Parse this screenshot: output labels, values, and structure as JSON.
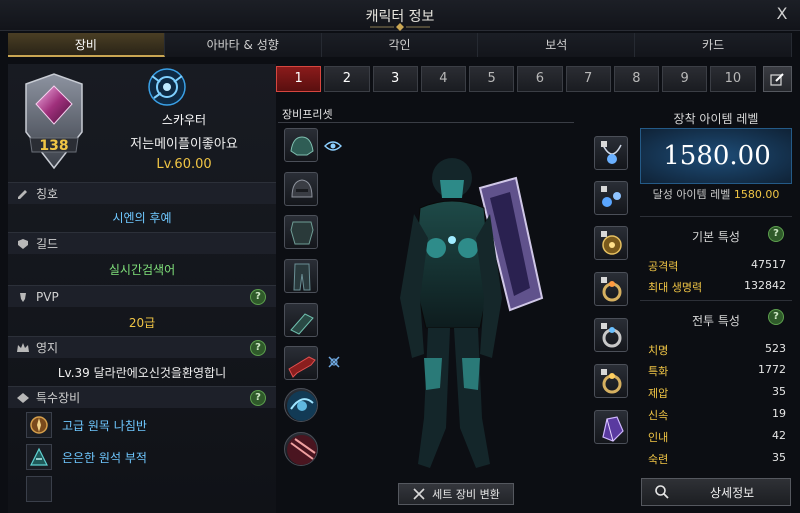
{
  "window": {
    "title": "캐릭터 정보",
    "close": "X"
  },
  "tabs": [
    {
      "label": "장비",
      "active": true
    },
    {
      "label": "아바타 & 성향",
      "active": false
    },
    {
      "label": "각인",
      "active": false
    },
    {
      "label": "보석",
      "active": false
    },
    {
      "label": "카드",
      "active": false
    }
  ],
  "profile": {
    "emblem_level": "138",
    "class_name": "스카우터",
    "character_name": "저는메이플이좋아요",
    "level": "Lv.60.00"
  },
  "sections": {
    "title": {
      "label": "칭호",
      "value": "시엔의 후예"
    },
    "guild": {
      "label": "길드",
      "value": "실시간검색어"
    },
    "pvp": {
      "label": "PVP",
      "value": "20급"
    },
    "territory": {
      "label": "영지",
      "value": "Lv.39 달라란에오신것을환영합니"
    },
    "special": {
      "label": "특수장비",
      "items": [
        {
          "label": "고급 원목 나침반"
        },
        {
          "label": "은은한 원석 부적"
        }
      ]
    },
    "help_glyph": "?"
  },
  "slots": [
    "1",
    "2",
    "3",
    "4",
    "5",
    "6",
    "7",
    "8",
    "9",
    "10"
  ],
  "preset": {
    "label": "장비프리셋",
    "set_button": "세트 장비 변환"
  },
  "item_level": {
    "title": "장착 아이템 레벨",
    "value": "1580.00",
    "achieved_label": "달성 아이템 레벨",
    "achieved_value": "1580.00"
  },
  "basic_stats": {
    "title": "기본 특성",
    "rows": [
      {
        "k": "공격력",
        "v": "47517"
      },
      {
        "k": "최대 생명력",
        "v": "132842"
      }
    ]
  },
  "combat_stats": {
    "title": "전투 특성",
    "rows": [
      {
        "k": "치명",
        "v": "523"
      },
      {
        "k": "특화",
        "v": "1772"
      },
      {
        "k": "제압",
        "v": "35"
      },
      {
        "k": "신속",
        "v": "19"
      },
      {
        "k": "인내",
        "v": "42"
      },
      {
        "k": "숙련",
        "v": "35"
      }
    ]
  },
  "detail_button": "상세정보",
  "colors": {
    "accent_gold": "#f0c545",
    "cyan": "#6fc8ff",
    "green": "#7fe07a",
    "active_red": "#8a1b1b"
  }
}
